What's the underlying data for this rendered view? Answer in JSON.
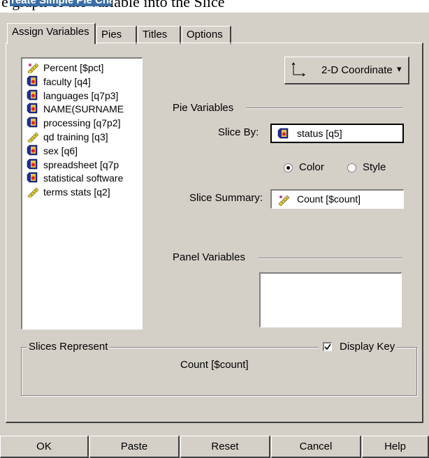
{
  "window": {
    "title": "reate Simple Pie Chart",
    "background_caption": "e graph of the variable into the Slice"
  },
  "tabs": [
    {
      "label": "Assign Variables",
      "active": true
    },
    {
      "label": "Pies",
      "active": false
    },
    {
      "label": "Titles",
      "active": false
    },
    {
      "label": "Options",
      "active": false
    }
  ],
  "variables": [
    {
      "label": "Percent [$pct]",
      "icon": "scale-icon"
    },
    {
      "label": "faculty [q4]",
      "icon": "nominal-icon"
    },
    {
      "label": "languages [q7p3]",
      "icon": "nominal-icon"
    },
    {
      "label": "NAME(SURNAME",
      "icon": "nominal-icon"
    },
    {
      "label": "processing [q7p2]",
      "icon": "nominal-icon"
    },
    {
      "label": "qd training [q3]",
      "icon": "scale-icon"
    },
    {
      "label": "sex [q6]",
      "icon": "nominal-icon"
    },
    {
      "label": "spreadsheet [q7p",
      "icon": "nominal-icon"
    },
    {
      "label": "statistical software",
      "icon": "nominal-icon"
    },
    {
      "label": "terms stats [q2]",
      "icon": "scale-icon"
    }
  ],
  "coordinate": {
    "label": "2-D Coordinate",
    "arrow": "▾"
  },
  "pie_variables": {
    "heading": "Pie Variables",
    "slice_by_label": "Slice By:",
    "slice_by_value": "status [q5]",
    "color_label": "Color",
    "style_label": "Style",
    "selected": "Color",
    "slice_summary_label": "Slice Summary:",
    "slice_summary_value": "Count [$count]"
  },
  "panel_variables": {
    "heading": "Panel Variables"
  },
  "slices_represent": {
    "heading": "Slices Represent",
    "display_key_label": "Display Key",
    "display_key_checked": true,
    "value": "Count [$count]"
  },
  "buttons": {
    "ok": "OK",
    "paste": "Paste",
    "reset": "Reset",
    "cancel": "Cancel",
    "help": "Help"
  }
}
